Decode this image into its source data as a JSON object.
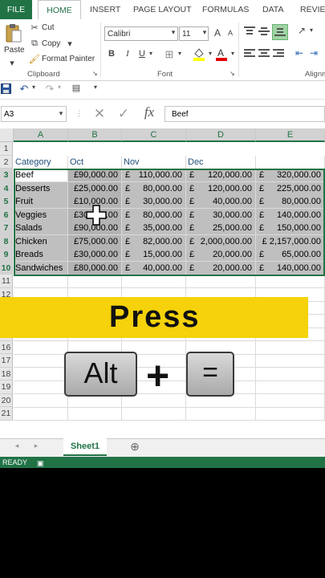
{
  "ribbon_tabs": [
    "FILE",
    "HOME",
    "INSERT",
    "PAGE LAYOUT",
    "FORMULAS",
    "DATA",
    "REVIEW"
  ],
  "clipboard": {
    "paste": "Paste",
    "cut": "Cut",
    "copy": "Copy",
    "format_painter": "Format Painter",
    "label": "Clipboard"
  },
  "font": {
    "name": "Calibri",
    "size": "11",
    "grow": "A",
    "shrink": "A",
    "bold": "B",
    "italic": "I",
    "underline": "U",
    "label": "Font"
  },
  "alignment": {
    "label": "Alignm"
  },
  "name_box": "A3",
  "formula_value": "Beef",
  "fx_symbol": "fx",
  "columns": [
    "A",
    "B",
    "C",
    "D",
    "E"
  ],
  "rows": [
    "1",
    "2",
    "3",
    "4",
    "5",
    "6",
    "7",
    "8",
    "9",
    "10",
    "11",
    "12",
    "13",
    "14",
    "15",
    "16",
    "17",
    "18",
    "19",
    "20",
    "21"
  ],
  "table": {
    "headers": [
      "Category",
      "Oct",
      "Nov",
      "Dec",
      ""
    ],
    "currency": "£",
    "data": [
      {
        "cat": "Beef",
        "oct": "£90,000.00",
        "nov": "110,000.00",
        "dec": "120,000.00",
        "tot": "320,000.00"
      },
      {
        "cat": "Desserts",
        "oct": "£25,000.00",
        "nov": "80,000.00",
        "dec": "120,000.00",
        "tot": "225,000.00"
      },
      {
        "cat": "Fruit",
        "oct": "£10,000.00",
        "nov": "30,000.00",
        "dec": "40,000.00",
        "tot": "80,000.00"
      },
      {
        "cat": "Veggies",
        "oct": "£30,000.00",
        "nov": "80,000.00",
        "dec": "30,000.00",
        "tot": "140,000.00"
      },
      {
        "cat": "Salads",
        "oct": "£90,000.00",
        "nov": "35,000.00",
        "dec": "25,000.00",
        "tot": "150,000.00"
      },
      {
        "cat": "Chicken",
        "oct": "£75,000.00",
        "nov": "82,000.00",
        "dec": "2,000,000.00",
        "tot": "£ 2,157,000.00"
      },
      {
        "cat": "Breads",
        "oct": "£30,000.00",
        "nov": "15,000.00",
        "dec": "20,000.00",
        "tot": "65,000.00"
      },
      {
        "cat": "Sandwiches",
        "oct": "£80,000.00",
        "nov": "40,000.00",
        "dec": "20,000.00",
        "tot": "140,000.00"
      }
    ]
  },
  "overlay": {
    "press": "Press",
    "key1": "Alt",
    "plus": "+",
    "key2": "="
  },
  "sheet_tab": "Sheet1",
  "status": "READY",
  "colors": {
    "excel_green": "#217346",
    "highlight": "#f5d20b"
  }
}
